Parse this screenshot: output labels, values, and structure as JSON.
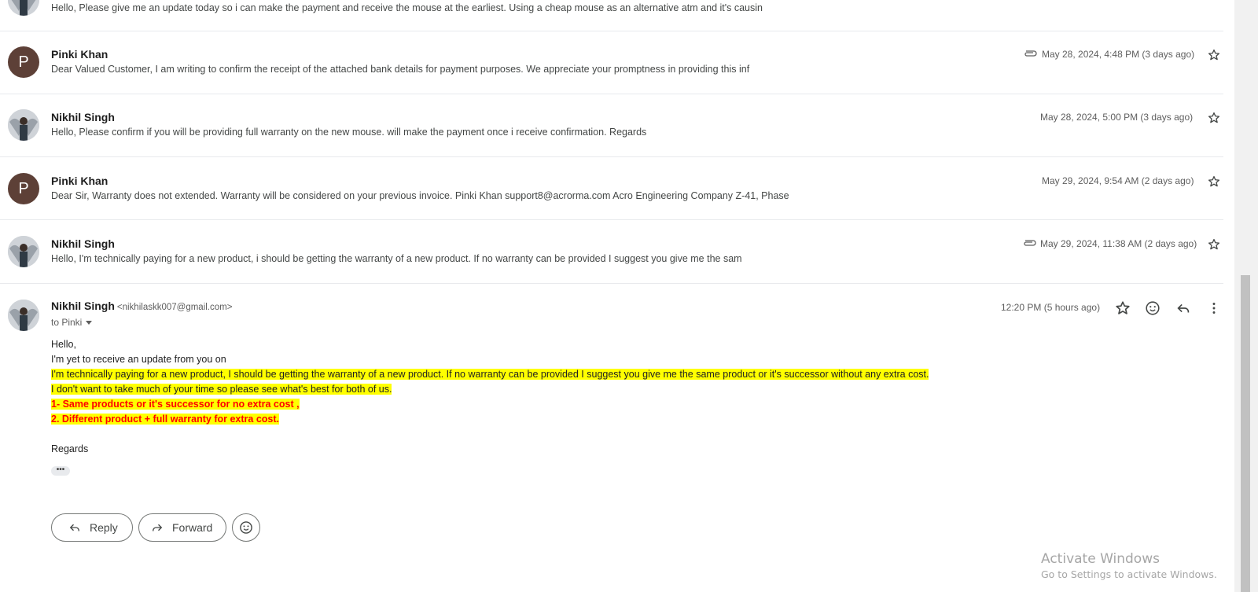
{
  "messages": [
    {
      "sender": "",
      "snippet": "Hello, Please give me an update today so i can make the payment and receive the mouse at the earliest. Using a cheap mouse as an alternative atm and it's causin",
      "date": "",
      "avatar": "photo",
      "has_attachment": false
    },
    {
      "sender": "Pinki Khan",
      "snippet": "Dear Valued Customer, I am writing to confirm the receipt of the attached bank details for payment purposes. We appreciate your promptness in providing this inf",
      "date": "May 28, 2024, 4:48 PM (3 days ago)",
      "avatar": "letter",
      "avatar_letter": "P",
      "has_attachment": true
    },
    {
      "sender": "Nikhil Singh",
      "snippet": "Hello, Please confirm if you will be providing full warranty on the new mouse. will make the payment once i receive confirmation. Regards",
      "date": "May 28, 2024, 5:00 PM (3 days ago)",
      "avatar": "photo",
      "has_attachment": false
    },
    {
      "sender": "Pinki Khan",
      "snippet": "Dear Sir, Warranty does not extended. Warranty will be considered on your previous invoice. Pinki Khan support8@acrorma.com Acro Engineering Company Z-41, Phase",
      "date": "May 29, 2024, 9:54 AM (2 days ago)",
      "avatar": "letter",
      "avatar_letter": "P",
      "has_attachment": false
    },
    {
      "sender": "Nikhil Singh",
      "snippet": "Hello, I'm technically paying for a new product, i should be getting the warranty of a new product. If no warranty can be provided I suggest you give me the sam",
      "date": "May 29, 2024, 11:38 AM (2 days ago)",
      "avatar": "photo",
      "has_attachment": true
    }
  ],
  "expanded": {
    "sender": "Nikhil Singh",
    "email": "<nikhilaskk007@gmail.com>",
    "to": "to Pinki",
    "date": "12:20 PM (5 hours ago)",
    "body": {
      "greeting": "Hello,",
      "line1": "I'm yet to receive an update from you on",
      "line2": "I'm technically paying for a new product, I should be getting the warranty of a new product. If no warranty can be provided I suggest you give me the same product or it's successor without any extra cost.",
      "line3": "I don't want to take much of your time so please see what's best for both of us.",
      "option1": "1- Same products or it's successor for no extra cost ,",
      "option2": "2. Different product + full warranty for extra cost.",
      "closing": "Regards",
      "ellipsis": "•••"
    }
  },
  "actions": {
    "reply": "Reply",
    "forward": "Forward"
  },
  "watermark": {
    "title": "Activate Windows",
    "subtitle": "Go to Settings to activate Windows."
  },
  "colors": {
    "highlight": "#ffff00",
    "emphasis": "#ff0000",
    "avatar_letter_bg": "#5d4037"
  }
}
